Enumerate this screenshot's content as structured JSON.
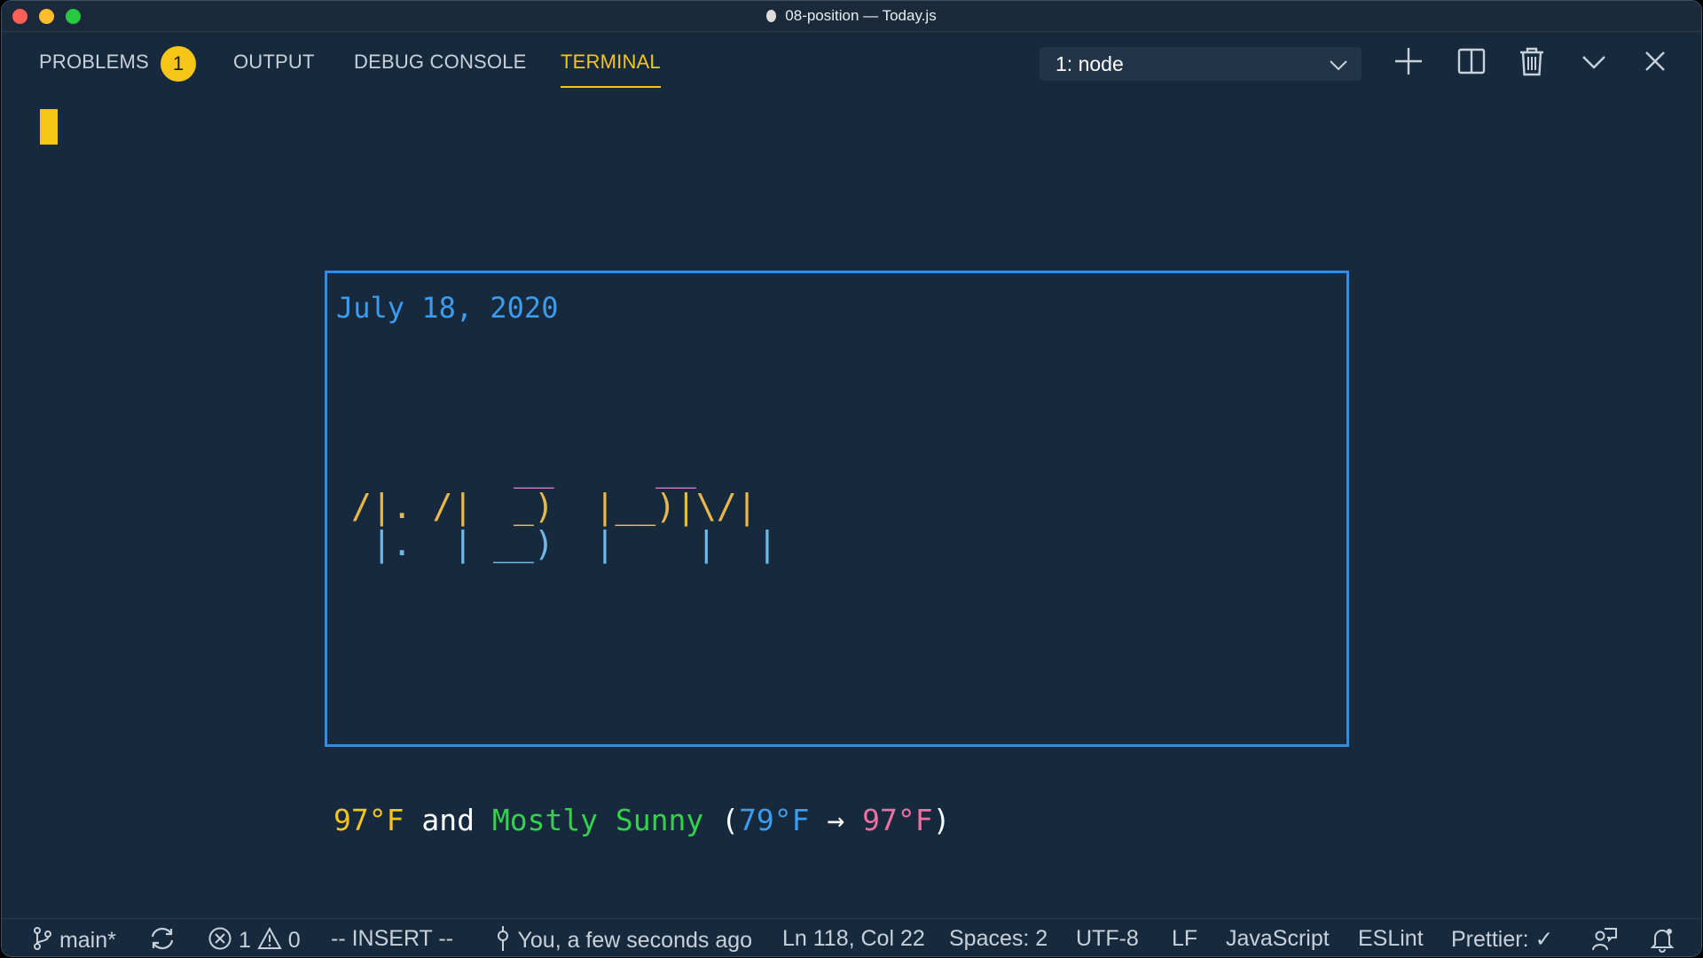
{
  "window": {
    "title": "08-position — Today.js"
  },
  "tabs": {
    "problems": "PROBLEMS",
    "problems_count": "1",
    "output": "OUTPUT",
    "debug_console": "DEBUG CONSOLE",
    "terminal": "TERMINAL"
  },
  "terminal_selector": {
    "selected": "1: node"
  },
  "terminal": {
    "date": "July 18, 2020",
    "clock_art": {
      "row1": "        __     __",
      "row2": "/|. /|  _)  |__)|\\/|",
      "row3": " |.  | __)  |    |  |"
    },
    "weather": {
      "current_temp": "97°F",
      "conjunction": "and",
      "condition": "Mostly Sunny",
      "open_paren": "(",
      "low": "79°F",
      "arrow": "→",
      "high": "97°F",
      "close_paren": ")"
    }
  },
  "statusbar": {
    "branch": "main*",
    "errors": "1",
    "warnings": "0",
    "mode": "-- INSERT --",
    "blame": "You, a few seconds ago",
    "position": "Ln 118, Col 22",
    "spaces": "Spaces: 2",
    "encoding": "UTF-8",
    "eol": "LF",
    "language": "JavaScript",
    "linter": "ESLint",
    "prettier": "Prettier: ✓"
  },
  "icons": {
    "new_terminal": "plus-icon",
    "split": "split-icon",
    "kill": "trash-icon",
    "maximize": "chevron-down-icon",
    "close": "close-icon"
  },
  "colors": {
    "background": "#172a3d",
    "accent": "#f5c518",
    "frame_border": "#2f8ee9",
    "date": "#3b9cf0"
  }
}
